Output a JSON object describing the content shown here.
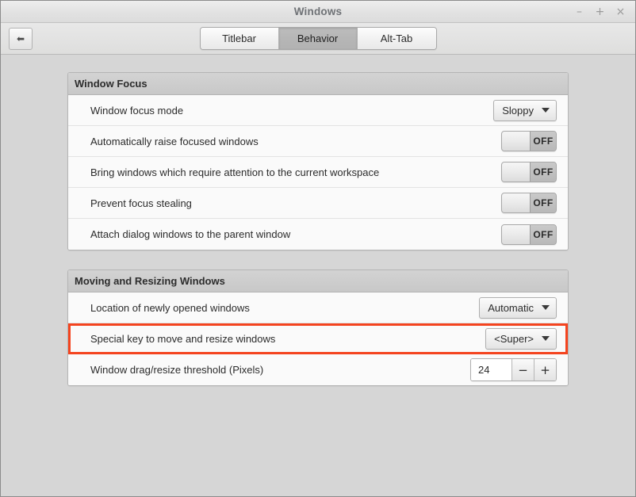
{
  "window": {
    "title": "Windows",
    "controls": [
      {
        "name": "minimize-button",
        "glyph": "–"
      },
      {
        "name": "maximize-button",
        "glyph": "+"
      },
      {
        "name": "close-button",
        "glyph": "×"
      }
    ]
  },
  "toolbar": {
    "back_glyph": "⬅",
    "tabs": [
      {
        "label": "Titlebar",
        "active": false
      },
      {
        "label": "Behavior",
        "active": true
      },
      {
        "label": "Alt-Tab",
        "active": false
      }
    ]
  },
  "colors": {
    "highlight": "#f4441f",
    "window_bg": "#d6d6d6",
    "row_bg": "#fafafa",
    "group_header_bg": "#cccccc"
  },
  "groups": [
    {
      "title": "Window Focus",
      "rows": [
        {
          "label": "Window focus mode",
          "control": "dropdown",
          "value": "Sloppy",
          "highlighted": false
        },
        {
          "label": "Automatically raise focused windows",
          "control": "toggle",
          "value": "OFF",
          "highlighted": false
        },
        {
          "label": "Bring windows which require attention to the current workspace",
          "control": "toggle",
          "value": "OFF",
          "highlighted": false
        },
        {
          "label": "Prevent focus stealing",
          "control": "toggle",
          "value": "OFF",
          "highlighted": false
        },
        {
          "label": "Attach dialog windows to the parent window",
          "control": "toggle",
          "value": "OFF",
          "highlighted": false
        }
      ]
    },
    {
      "title": "Moving and Resizing Windows",
      "rows": [
        {
          "label": "Location of newly opened windows",
          "control": "dropdown",
          "value": "Automatic",
          "highlighted": false
        },
        {
          "label": "Special key to move and resize windows",
          "control": "dropdown",
          "value": "<Super>",
          "highlighted": true
        },
        {
          "label": "Window drag/resize threshold (Pixels)",
          "control": "spinner",
          "value": "24",
          "decrement_glyph": "−",
          "increment_glyph": "+",
          "highlighted": false
        }
      ]
    }
  ]
}
